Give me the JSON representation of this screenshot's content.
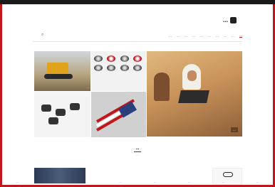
{
  "site": {
    "logo_text": "…"
  },
  "nav": {
    "items": [
      "…",
      "…",
      "…",
      "…",
      "…",
      "…",
      "…",
      "…",
      "…",
      "…"
    ]
  },
  "tiles": {
    "main_caption": "…",
    "parts_caption": "…",
    "flag_caption": "…",
    "logos_caption": "…",
    "bulldozer_caption": "…"
  },
  "section": {
    "title": "…",
    "subtitle": "…"
  },
  "footer_status": [
    "…",
    "…",
    "…",
    "…",
    "…",
    "…",
    "…",
    "…"
  ],
  "colors": {
    "accent": "#c0161c",
    "frame": "#c0161c"
  },
  "icons": {
    "search": "search-icon",
    "logo": "logo-icon"
  }
}
